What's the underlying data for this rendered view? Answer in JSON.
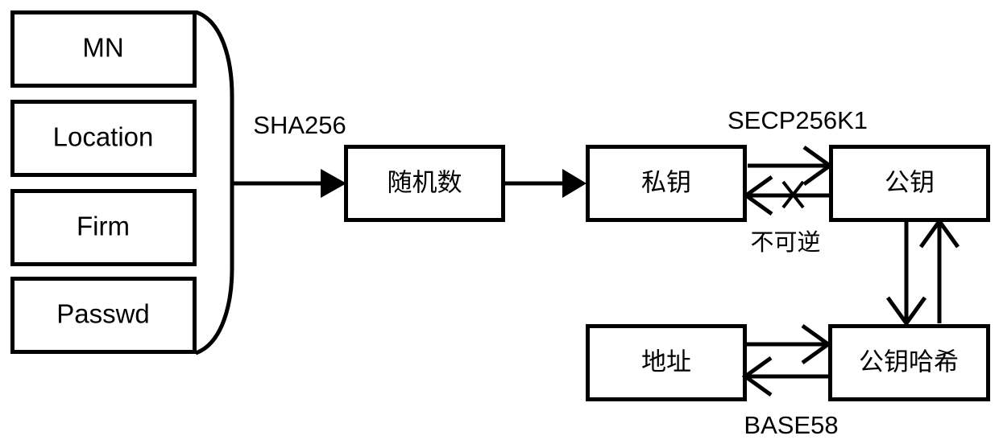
{
  "diagram": {
    "title": "Bitcoin wallet key and address derivation flow",
    "colors": {
      "stroke": "#000000",
      "fill": "#ffffff",
      "background": "#ffffff"
    },
    "input_group": {
      "brace_kind": "right-curly-brace",
      "items": [
        {
          "id": "mn",
          "label": "MN"
        },
        {
          "id": "location",
          "label": "Location"
        },
        {
          "id": "firm",
          "label": "Firm"
        },
        {
          "id": "passwd",
          "label": "Passwd"
        }
      ]
    },
    "nodes": [
      {
        "id": "random",
        "label": "随机数"
      },
      {
        "id": "privkey",
        "label": "私钥"
      },
      {
        "id": "pubkey",
        "label": "公钥"
      },
      {
        "id": "address",
        "label": "地址"
      },
      {
        "id": "pubkeyhash",
        "label": "公钥哈希"
      }
    ],
    "edge_labels": [
      {
        "id": "sha256",
        "label": "SHA256"
      },
      {
        "id": "secp256k1",
        "label": "SECP256K1"
      },
      {
        "id": "irreversible",
        "label": "不可逆"
      },
      {
        "id": "base58",
        "label": "BASE58"
      }
    ],
    "edges": [
      {
        "id": "inputs-to-random",
        "from": "input_group",
        "to": "random",
        "direction": "right",
        "label": "SHA256",
        "head": "solid"
      },
      {
        "id": "random-to-privkey",
        "from": "random",
        "to": "privkey",
        "direction": "right",
        "label": "",
        "head": "solid"
      },
      {
        "id": "privkey-to-pubkey",
        "from": "privkey",
        "to": "pubkey",
        "direction": "right",
        "label": "SECP256K1",
        "head": "open"
      },
      {
        "id": "pubkey-to-privkey",
        "from": "pubkey",
        "to": "privkey",
        "direction": "left",
        "label": "不可逆",
        "head": "open",
        "blocked": true,
        "blocked_marker": "x"
      },
      {
        "id": "pubkey-to-pubkeyhash",
        "from": "pubkey",
        "to": "pubkeyhash",
        "direction": "down",
        "label": "",
        "head": "open"
      },
      {
        "id": "pubkeyhash-to-pubkey",
        "from": "pubkeyhash",
        "to": "pubkey",
        "direction": "up",
        "label": "",
        "head": "open"
      },
      {
        "id": "address-to-pubkeyhash",
        "from": "address",
        "to": "pubkeyhash",
        "direction": "right",
        "label": "",
        "head": "open"
      },
      {
        "id": "pubkeyhash-to-address",
        "from": "pubkeyhash",
        "to": "address",
        "direction": "left",
        "label": "BASE58",
        "head": "open"
      }
    ]
  }
}
